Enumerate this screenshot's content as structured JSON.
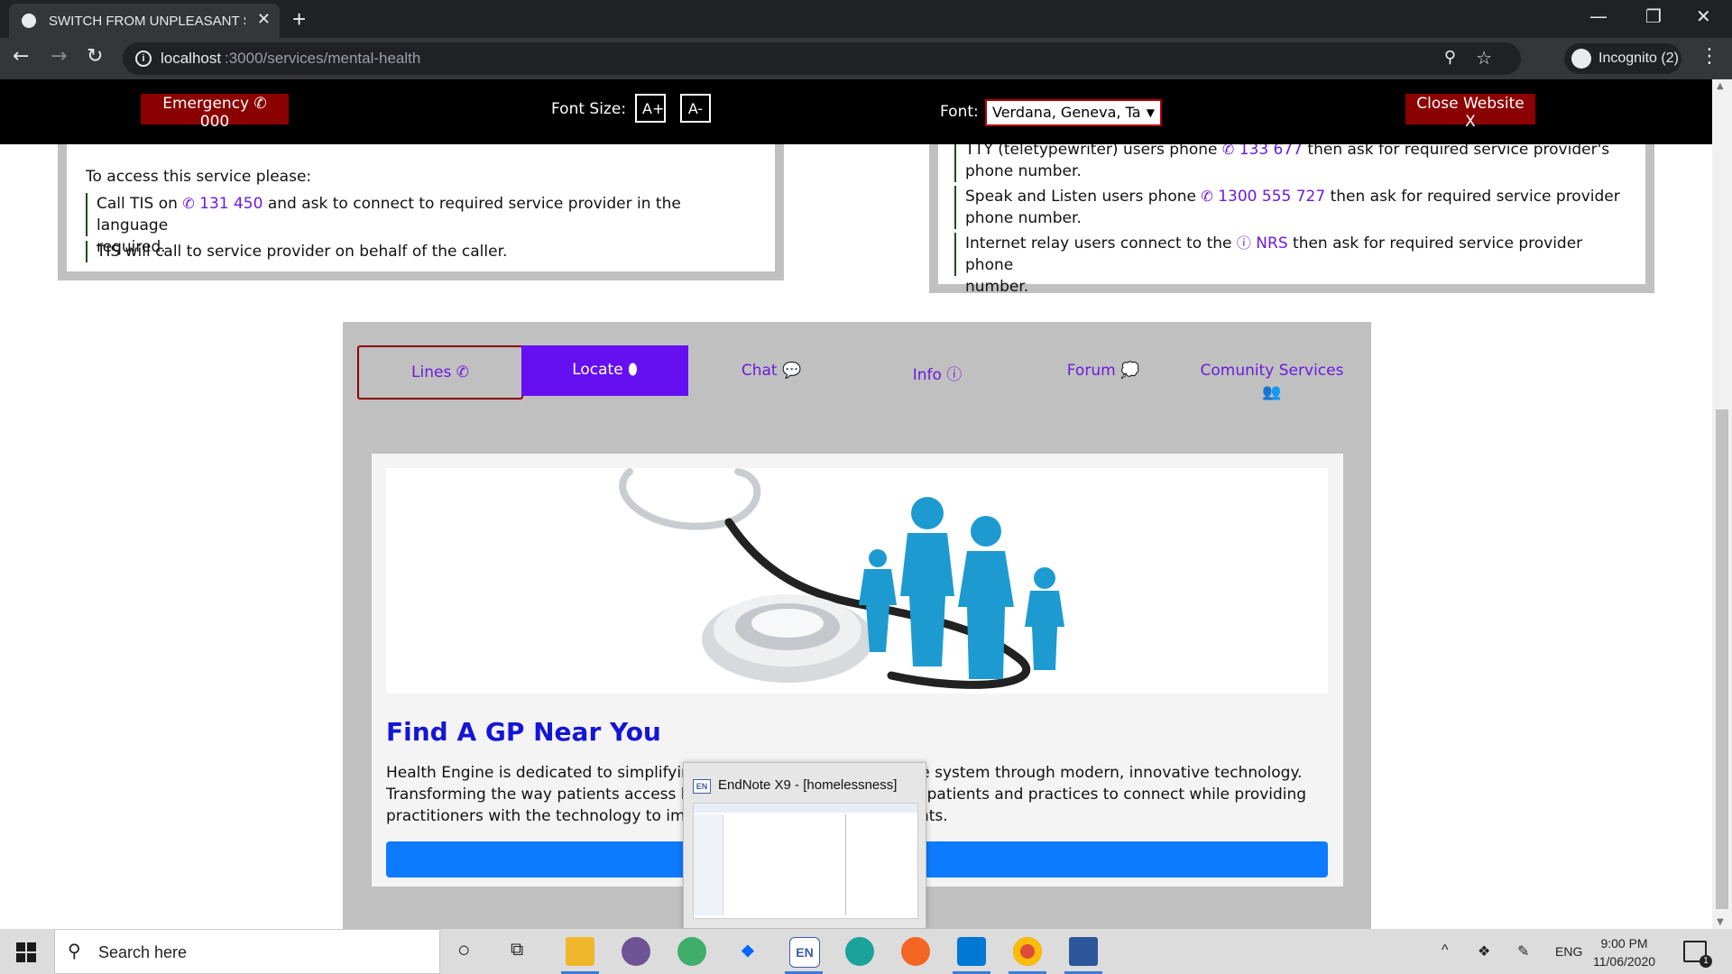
{
  "browser": {
    "tab_title": "SWITCH FROM UNPLEASANT SC",
    "tab_close": "✕",
    "new_tab": "+",
    "url_host": "localhost",
    "url_path": ":3000/services/mental-health",
    "profile_label": "Incognito (2)",
    "window_minimize": "—",
    "window_restore": "❐",
    "window_close": "✕"
  },
  "accessibility_bar": {
    "emergency_label": "Emergency",
    "emergency_number": "000",
    "font_size_label": "Font Size:",
    "increase_label": "A+",
    "decrease_label": "A-",
    "font_label": "Font:",
    "font_selected": "Verdana, Geneva, Ta",
    "close_website_label": "Close Website X"
  },
  "tis_card": {
    "intro": "To access this service please:",
    "step1_prefix": "Call TIS on",
    "step1_number": "131 450",
    "step1_suffix_a": "and ask to connect to required service provider in the language",
    "step1_suffix_b": "required.",
    "step2": "TIS will call to service provider on behalf of the caller."
  },
  "nrs_card": {
    "tty_prefix": "TTY (teletypewriter) users phone",
    "tty_number": "133 677",
    "tty_suffix": "then ask for required service provider's",
    "tty_line2": "phone number.",
    "speak_prefix": "Speak and Listen users phone",
    "speak_number": "1300 555 727",
    "speak_suffix": "then ask for required service provider",
    "speak_line2": "phone number.",
    "relay_prefix": "Internet relay users connect to the",
    "relay_link": "NRS",
    "relay_suffix": "then ask for required service provider phone",
    "relay_line2": "number."
  },
  "service_tabs": {
    "lines": "Lines",
    "locate": "Locate",
    "chat": "Chat",
    "info": "Info",
    "forum": "Forum",
    "community": "Comunity Services"
  },
  "locate": {
    "title": "Find A GP Near You",
    "desc_line1": "Health Engine is dedicated to simplifying Australia complex healthcare system through modern, innovative technology.",
    "desc_line2": "Transforming the way patients access healthcare, making it easier for patients and practices to connect while providing",
    "desc_line3": "practitioners with the technology to improve outcomes for their patients."
  },
  "taskbar_popup": {
    "title": "EndNote X9 - [homelessness]",
    "app_badge": "EN"
  },
  "taskbar": {
    "search_placeholder": "Search here",
    "lang": "ENG",
    "time": "9:00 PM",
    "date": "11/06/2020",
    "notification_count": "1",
    "endnote_badge": "EN"
  },
  "colors": {
    "accent_purple": "#6610f2",
    "link_purple": "#6a1bdb",
    "emergency_red": "#8b0000",
    "title_blue": "#1515d6",
    "button_blue": "#0d7bff"
  }
}
